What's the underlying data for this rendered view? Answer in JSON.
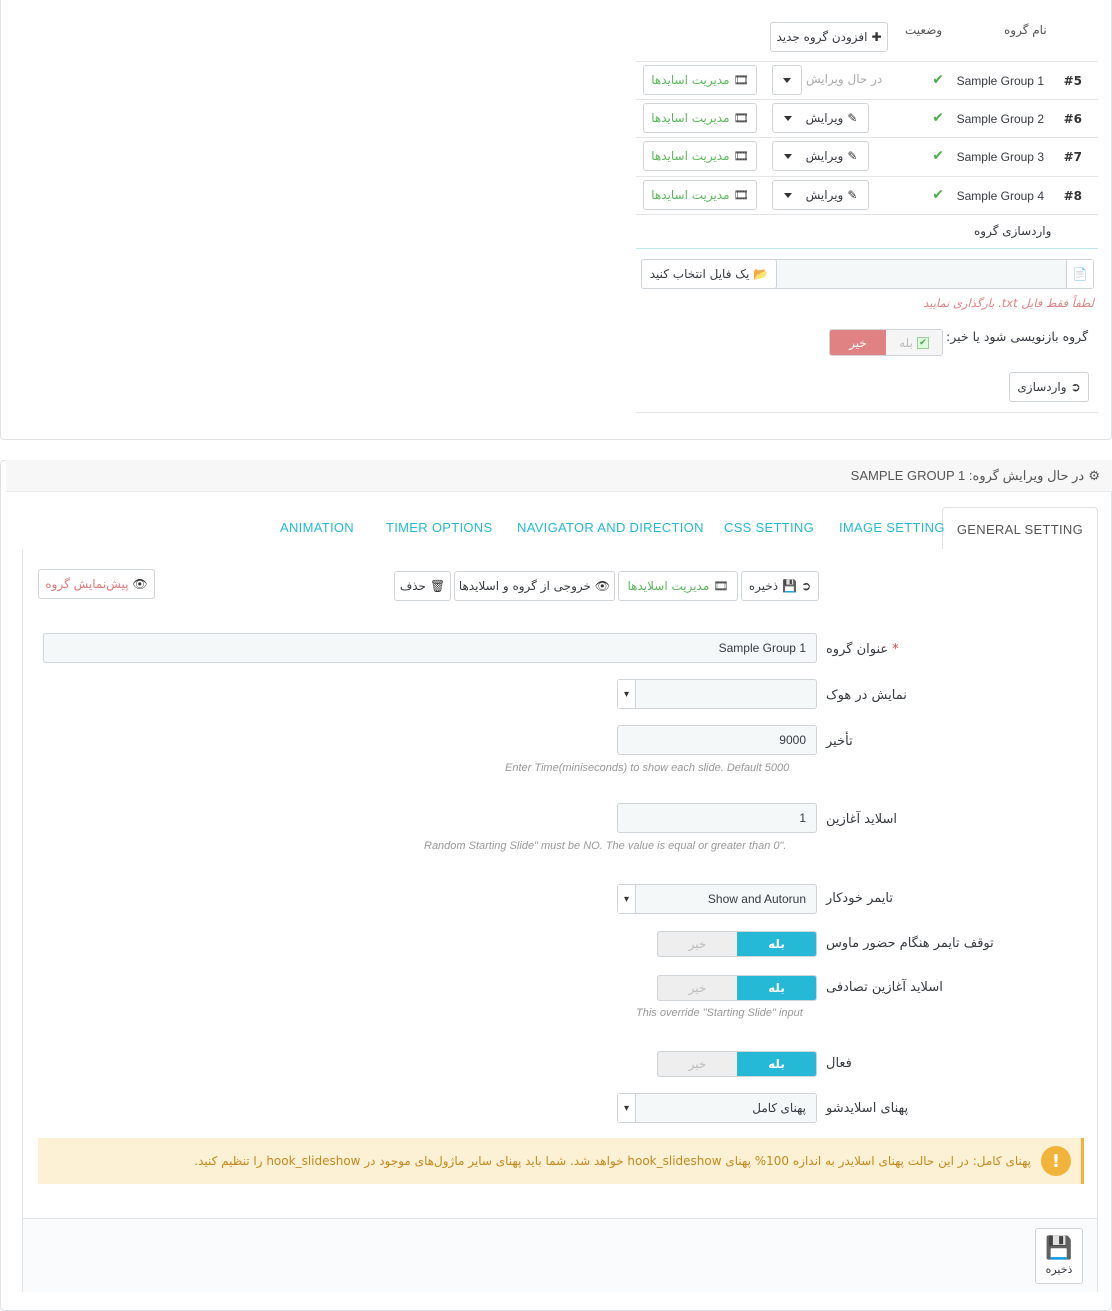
{
  "table": {
    "headers": {
      "name": "نام گروه",
      "status": "وضعیت"
    },
    "add_group_label": "افزودن گروه جدید",
    "rows": [
      {
        "num": "#5",
        "name": "Sample Group 1",
        "action": "در حال ویرایش",
        "manage": "مدیریت اسایدها"
      },
      {
        "num": "#6",
        "name": "Sample Group 2",
        "action": "ویرایش",
        "manage": "مدیریت اسایدها"
      },
      {
        "num": "#7",
        "name": "Sample Group 3",
        "action": "ویرایش",
        "manage": "مدیریت اسایدها"
      },
      {
        "num": "#8",
        "name": "Sample Group 4",
        "action": "ویرایش",
        "manage": "مدیریت اسایدها"
      }
    ]
  },
  "import": {
    "title": "واردسازی گروه",
    "choose_file": "یک فایل انتخاب کنید",
    "hint": "لطفاً فقط فایل txt. بارگذاری نمایید",
    "overwrite_label": "گروه بازنویسی شود یا خیر:",
    "yes": "بله",
    "no": "خیر",
    "import_button": "واردسازی"
  },
  "editor": {
    "heading": "در حال ویرایش گروه: SAMPLE GROUP 1",
    "tabs": [
      "GENERAL SETTING",
      "IMAGE SETTING",
      "CSS SETTING",
      "NAVIGATOR AND DIRECTION",
      "TIMER OPTIONS",
      "ANIMATION"
    ],
    "toolbar": {
      "save": "ذخیره",
      "manage": "مدیریت اسلایدها",
      "export": "خروجی از گروه و اسلایدها",
      "delete": "حذف",
      "preview": "پیش‌نمایش گروه"
    },
    "form": {
      "title_label": "عنوان گروه",
      "title_value": "Sample Group 1",
      "hook_label": "نمایش در هوک",
      "delay_label": "تأخیر",
      "delay_value": "9000",
      "delay_help": "Enter Time(miniseconds) to show each slide. Default 5000",
      "start_label": "اسلاید آغازین",
      "start_value": "1",
      "start_help": "Random Starting Slide\" must be NO. The value is equal or greater than 0\".",
      "timer_label": "تایمر خودکار",
      "timer_value": "Show and Autorun",
      "pause_label": "توقف تایمر هنگام حضور ماوس",
      "random_label": "اسلاید آغازین تصادفی",
      "random_help": "This override \"Starting Slide\" input",
      "active_label": "فعال",
      "width_label": "پهنای اسلایدشو",
      "width_value": "پهنای کامل",
      "yes": "بله",
      "no": "خیر"
    },
    "warning": "پهنای کامل: در این حالت پهنای اسلایدر به اندازه 100% پهنای hook_slideshow خواهد شد. شما باید پهنای سایر ماژول‌های موجود در hook_slideshow را تنظیم کنید.",
    "footer_save": "ذخیره"
  },
  "colors": {
    "accent": "#25b9d7",
    "success": "#5cb85c",
    "danger": "#e08283",
    "warning_bg": "#fcf0d5"
  }
}
